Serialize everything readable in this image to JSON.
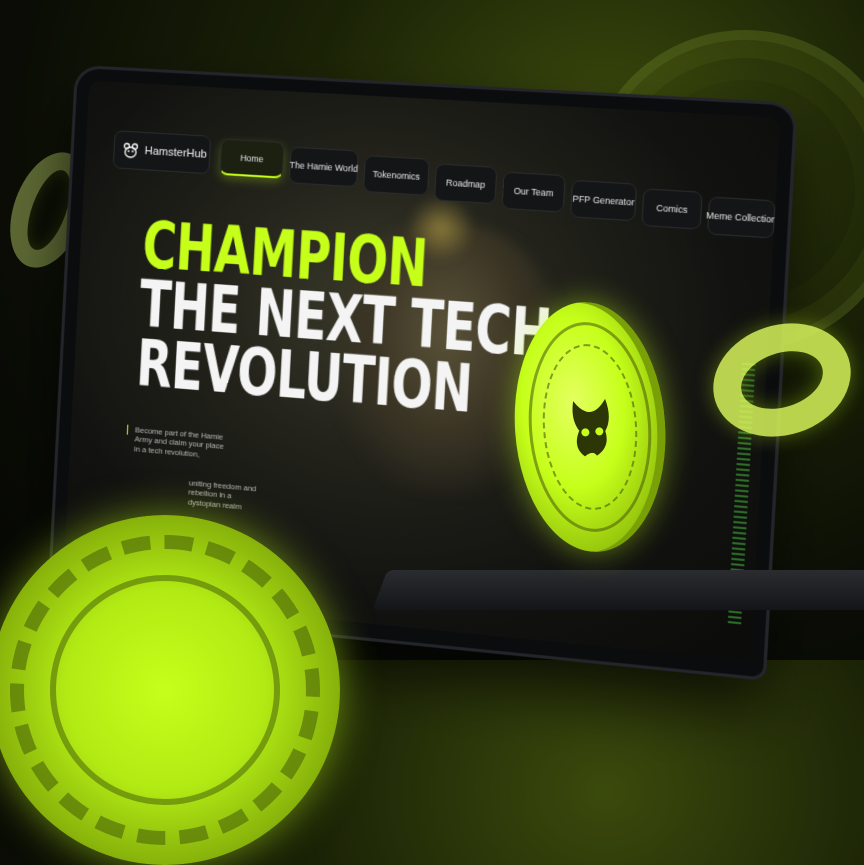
{
  "brand": {
    "name": "HamsterHub",
    "logo_icon": "hamster-logo-icon"
  },
  "nav": {
    "items": [
      {
        "label": "Home",
        "active": true
      },
      {
        "label": "The Hamie World",
        "active": false
      },
      {
        "label": "Tokenomics",
        "active": false
      },
      {
        "label": "Roadmap",
        "active": false
      },
      {
        "label": "Our Team",
        "active": false
      },
      {
        "label": "PFP Generator",
        "active": false
      },
      {
        "label": "Comics",
        "active": false
      },
      {
        "label": "Meme Collection",
        "active": false
      }
    ]
  },
  "hero": {
    "line1": "CHAMPION",
    "line2": "THE NEXT TECH",
    "line3": "REVOLUTION"
  },
  "blurbs": {
    "first": "Become part of the Hamie Army and claim your place in a tech revolution,",
    "second": "uniting freedom and rebellion in a dystopian realm"
  },
  "colors": {
    "accent": "#c6ff1a",
    "background": "#0a0c05",
    "nav_button": "#141516"
  },
  "decor": {
    "coin_icon": "hamster-coin-icon",
    "torus_icon": "glass-torus-icon"
  }
}
